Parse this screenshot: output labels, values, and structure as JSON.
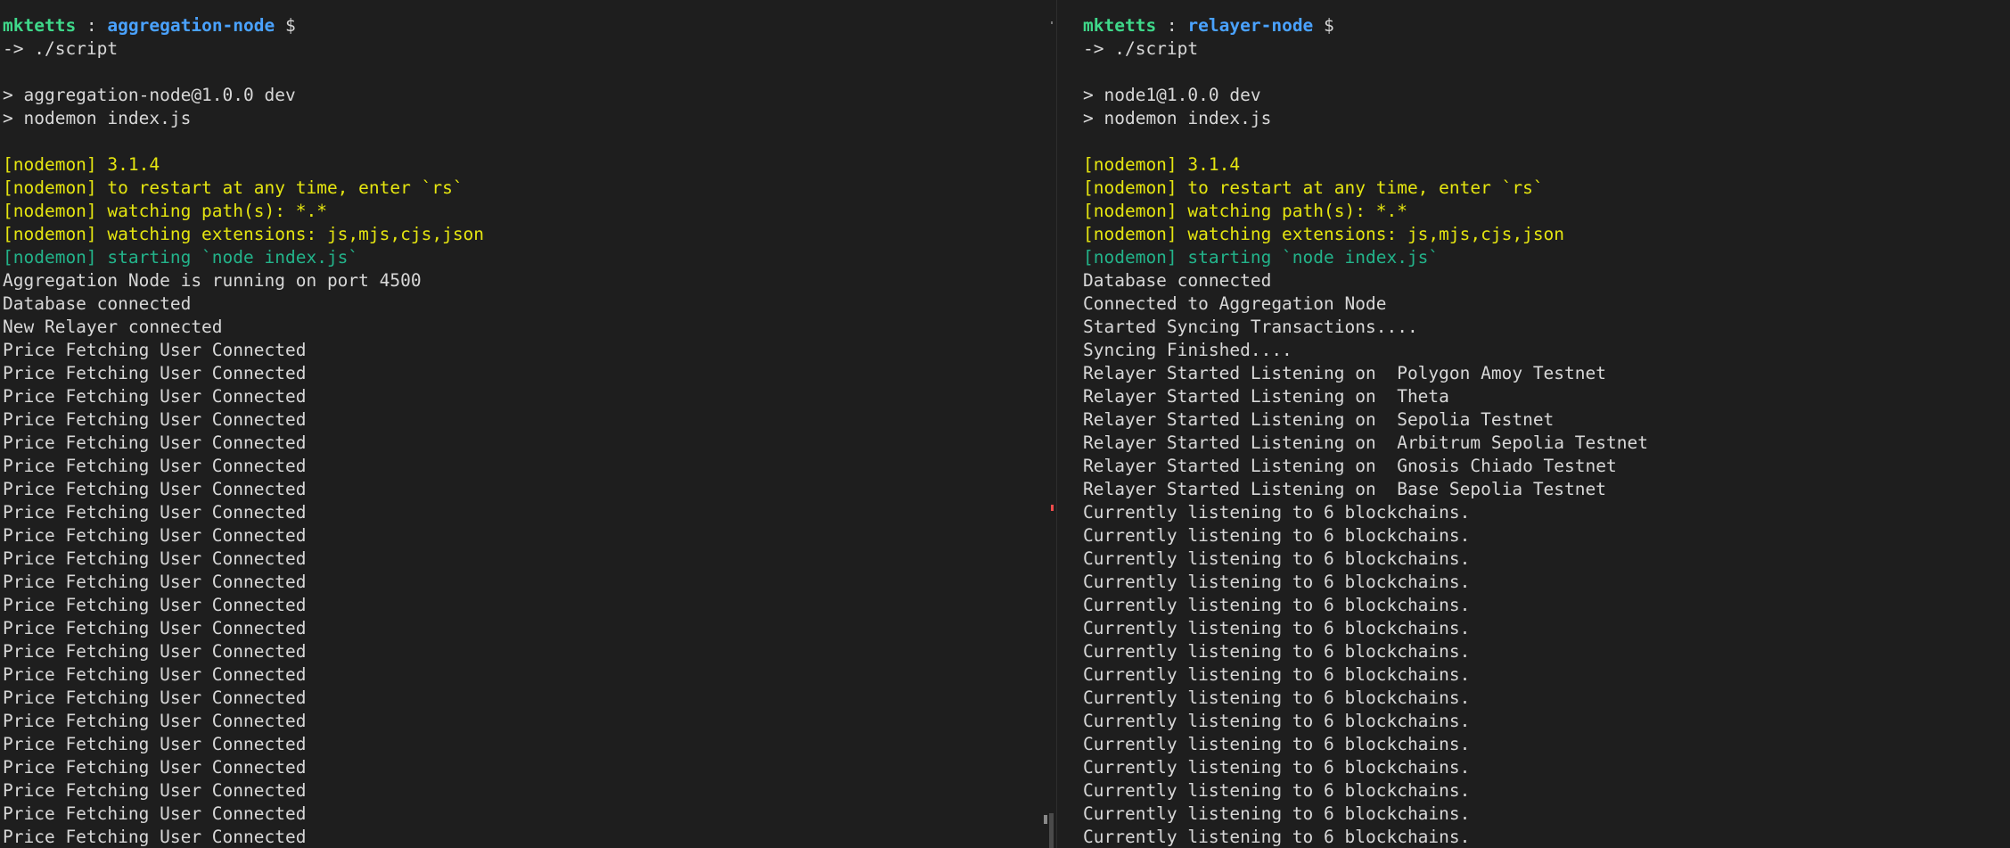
{
  "left_pane": {
    "prompt": {
      "user": "mktetts",
      "separator": " : ",
      "host": "aggregation-node",
      "symbol": " $"
    },
    "lines": [
      {
        "text": "-> ./script",
        "color": "default"
      },
      {
        "text": "",
        "color": "default"
      },
      {
        "text": "> aggregation-node@1.0.0 dev",
        "color": "default"
      },
      {
        "text": "> nodemon index.js",
        "color": "default"
      },
      {
        "text": "",
        "color": "default"
      },
      {
        "text": "[nodemon] 3.1.4",
        "color": "yellow"
      },
      {
        "text": "[nodemon] to restart at any time, enter `rs`",
        "color": "yellow"
      },
      {
        "text": "[nodemon] watching path(s): *.*",
        "color": "yellow"
      },
      {
        "text": "[nodemon] watching extensions: js,mjs,cjs,json",
        "color": "yellow"
      },
      {
        "text": "[nodemon] starting `node index.js`",
        "color": "green"
      },
      {
        "text": "Aggregation Node is running on port 4500",
        "color": "default"
      },
      {
        "text": "Database connected",
        "color": "default"
      },
      {
        "text": "New Relayer connected",
        "color": "default"
      },
      {
        "text": "Price Fetching User Connected",
        "color": "default"
      },
      {
        "text": "Price Fetching User Connected",
        "color": "default"
      },
      {
        "text": "Price Fetching User Connected",
        "color": "default"
      },
      {
        "text": "Price Fetching User Connected",
        "color": "default"
      },
      {
        "text": "Price Fetching User Connected",
        "color": "default"
      },
      {
        "text": "Price Fetching User Connected",
        "color": "default"
      },
      {
        "text": "Price Fetching User Connected",
        "color": "default"
      },
      {
        "text": "Price Fetching User Connected",
        "color": "default"
      },
      {
        "text": "Price Fetching User Connected",
        "color": "default"
      },
      {
        "text": "Price Fetching User Connected",
        "color": "default"
      },
      {
        "text": "Price Fetching User Connected",
        "color": "default"
      },
      {
        "text": "Price Fetching User Connected",
        "color": "default"
      },
      {
        "text": "Price Fetching User Connected",
        "color": "default"
      },
      {
        "text": "Price Fetching User Connected",
        "color": "default"
      },
      {
        "text": "Price Fetching User Connected",
        "color": "default"
      },
      {
        "text": "Price Fetching User Connected",
        "color": "default"
      },
      {
        "text": "Price Fetching User Connected",
        "color": "default"
      },
      {
        "text": "Price Fetching User Connected",
        "color": "default"
      },
      {
        "text": "Price Fetching User Connected",
        "color": "default"
      },
      {
        "text": "Price Fetching User Connected",
        "color": "default"
      },
      {
        "text": "Price Fetching User Connected",
        "color": "default"
      },
      {
        "text": "Price Fetching User Connected",
        "color": "default"
      },
      {
        "text": "Price Fetching User Connected",
        "color": "default"
      }
    ]
  },
  "right_pane": {
    "prompt": {
      "user": "mktetts",
      "separator": " : ",
      "host": "relayer-node",
      "symbol": " $"
    },
    "lines": [
      {
        "text": "-> ./script",
        "color": "default"
      },
      {
        "text": "",
        "color": "default"
      },
      {
        "text": "> node1@1.0.0 dev",
        "color": "default"
      },
      {
        "text": "> nodemon index.js",
        "color": "default"
      },
      {
        "text": "",
        "color": "default"
      },
      {
        "text": "[nodemon] 3.1.4",
        "color": "yellow"
      },
      {
        "text": "[nodemon] to restart at any time, enter `rs`",
        "color": "yellow"
      },
      {
        "text": "[nodemon] watching path(s): *.*",
        "color": "yellow"
      },
      {
        "text": "[nodemon] watching extensions: js,mjs,cjs,json",
        "color": "yellow"
      },
      {
        "text": "[nodemon] starting `node index.js`",
        "color": "green"
      },
      {
        "text": "Database connected",
        "color": "default"
      },
      {
        "text": "Connected to Aggregation Node",
        "color": "default"
      },
      {
        "text": "Started Syncing Transactions....",
        "color": "default"
      },
      {
        "text": "Syncing Finished....",
        "color": "default"
      },
      {
        "text": "Relayer Started Listening on  Polygon Amoy Testnet",
        "color": "default"
      },
      {
        "text": "Relayer Started Listening on  Theta",
        "color": "default"
      },
      {
        "text": "Relayer Started Listening on  Sepolia Testnet",
        "color": "default"
      },
      {
        "text": "Relayer Started Listening on  Arbitrum Sepolia Testnet",
        "color": "default"
      },
      {
        "text": "Relayer Started Listening on  Gnosis Chiado Testnet",
        "color": "default"
      },
      {
        "text": "Relayer Started Listening on  Base Sepolia Testnet",
        "color": "default"
      },
      {
        "text": "Currently listening to 6 blockchains.",
        "color": "default"
      },
      {
        "text": "Currently listening to 6 blockchains.",
        "color": "default"
      },
      {
        "text": "Currently listening to 6 blockchains.",
        "color": "default"
      },
      {
        "text": "Currently listening to 6 blockchains.",
        "color": "default"
      },
      {
        "text": "Currently listening to 6 blockchains.",
        "color": "default"
      },
      {
        "text": "Currently listening to 6 blockchains.",
        "color": "default"
      },
      {
        "text": "Currently listening to 6 blockchains.",
        "color": "default"
      },
      {
        "text": "Currently listening to 6 blockchains.",
        "color": "default"
      },
      {
        "text": "Currently listening to 6 blockchains.",
        "color": "default"
      },
      {
        "text": "Currently listening to 6 blockchains.",
        "color": "default"
      },
      {
        "text": "Currently listening to 6 blockchains.",
        "color": "default"
      },
      {
        "text": "Currently listening to 6 blockchains.",
        "color": "default"
      },
      {
        "text": "Currently listening to 6 blockchains.",
        "color": "default"
      },
      {
        "text": "Currently listening to 6 blockchains.",
        "color": "default"
      },
      {
        "text": "Currently listening to 6 blockchains.",
        "color": "default"
      },
      {
        "text": "Currently listening to 6 blockchains.",
        "color": "default"
      }
    ]
  },
  "colors": {
    "background": "#1e1e1e",
    "default": "#d8d8d8",
    "user": "#3fd88a",
    "host": "#4aa2ff",
    "yellow": "#e5e510",
    "green": "#23b38a",
    "error_marker": "#f14c4c"
  }
}
